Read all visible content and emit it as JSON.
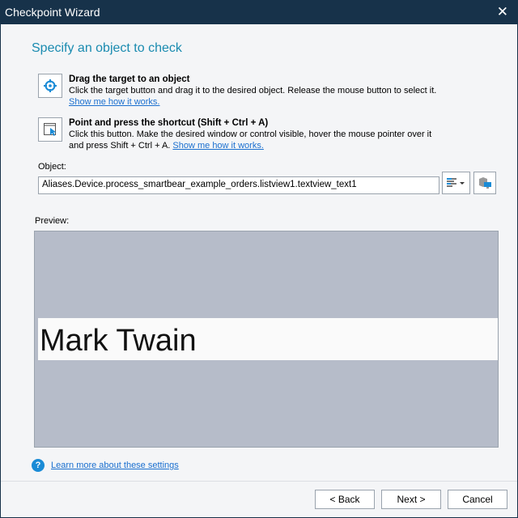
{
  "window": {
    "title": "Checkpoint Wizard"
  },
  "heading": "Specify an object to check",
  "drag": {
    "title": "Drag the target to an object",
    "desc": "Click the target button and drag it to the desired object. Release the mouse button to select it.",
    "link": "Show me how it works."
  },
  "point": {
    "title": "Point and press the shortcut (Shift + Ctrl + A)",
    "desc1": "Click this button. Make the desired window or control visible, hover the mouse pointer over it",
    "desc2": "and press Shift + Ctrl + A.",
    "link": "Show me how it works."
  },
  "object": {
    "label": "Object:",
    "value": "Aliases.Device.process_smartbear_example_orders.listview1.textview_text1"
  },
  "preview": {
    "label": "Preview:",
    "text": "Mark Twain"
  },
  "help_link": "Learn more about these settings",
  "buttons": {
    "back": "< Back",
    "next": "Next >",
    "cancel": "Cancel"
  }
}
